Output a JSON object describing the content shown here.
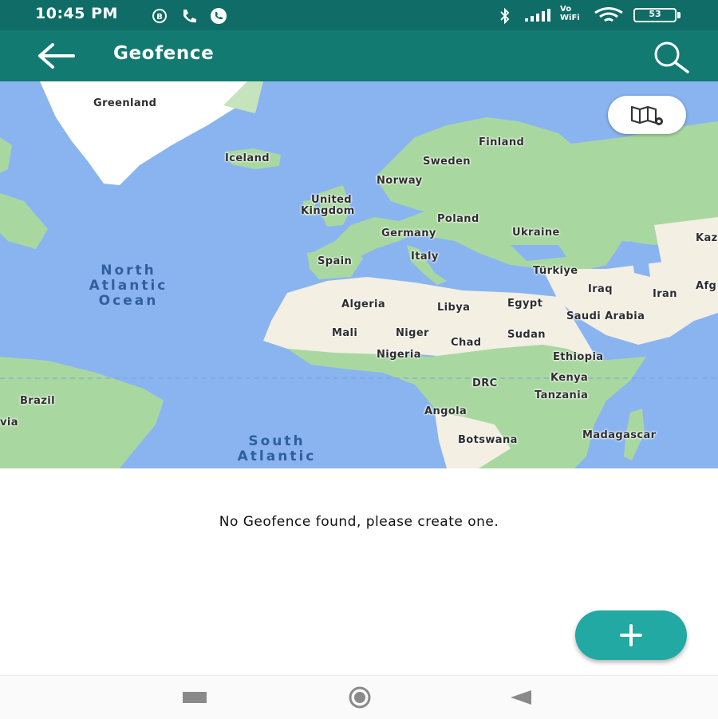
{
  "status_bar": {
    "time": "10:45 PM",
    "network_label": "Vo WiFi",
    "battery": "53"
  },
  "app_bar": {
    "title": "Geofence"
  },
  "map": {
    "labels": {
      "greenland": "Greenland",
      "iceland": "Iceland",
      "finland": "Finland",
      "sweden": "Sweden",
      "norway": "Norway",
      "uk_line1": "United",
      "uk_line2": "Kingdom",
      "poland": "Poland",
      "germany": "Germany",
      "ukraine": "Ukraine",
      "kaz": "Kaz",
      "spain": "Spain",
      "italy": "Italy",
      "turkiye": "Türkiye",
      "iraq": "Iraq",
      "iran": "Iran",
      "afg": "Afg",
      "algeria": "Algeria",
      "libya": "Libya",
      "egypt": "Egypt",
      "saudi": "Saudi Arabia",
      "mali": "Mali",
      "niger": "Niger",
      "chad": "Chad",
      "sudan": "Sudan",
      "nigeria": "Nigeria",
      "ethiopia": "Ethiopia",
      "kenya": "Kenya",
      "drc": "DRC",
      "tanzania": "Tanzania",
      "brazil": "Brazil",
      "via": "via",
      "angola": "Angola",
      "botswana": "Botswana",
      "madagascar": "Madagascar",
      "north_atlantic_1": "North",
      "north_atlantic_2": "Atlantic",
      "north_atlantic_3": "Ocean",
      "south_atlantic_1": "South",
      "south_atlantic_2": "Atlantic"
    }
  },
  "empty_state": {
    "message": "No Geofence found, please create one."
  },
  "icons": {
    "back": "arrow-left-icon",
    "search": "search-icon",
    "map_layers": "map-layers-icon",
    "add": "plus-icon"
  },
  "colors": {
    "status_bar": "#0f6c66",
    "app_bar": "#137a71",
    "fab": "#22a9a4",
    "water": "#8ab4f0",
    "land_green": "#a8d8a0",
    "land_sand": "#f3efe3"
  }
}
